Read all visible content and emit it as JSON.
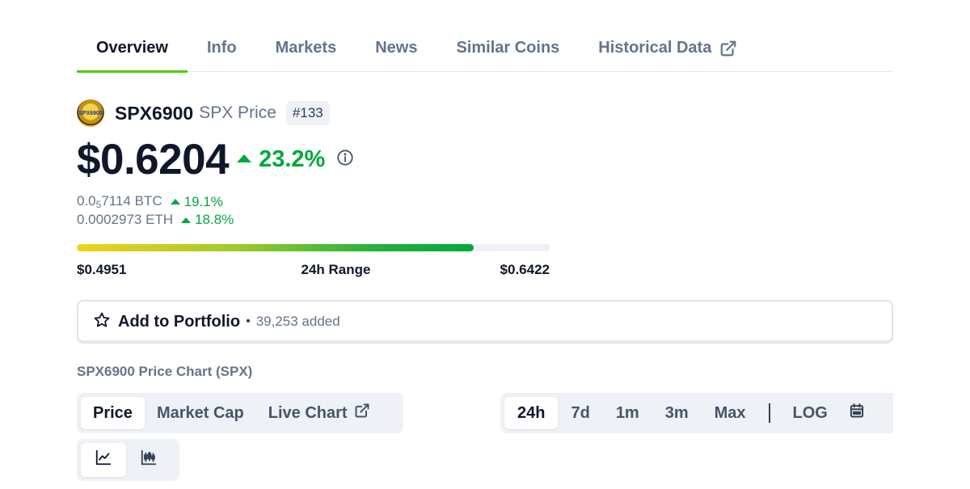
{
  "tabs": [
    {
      "label": "Overview",
      "active": true
    },
    {
      "label": "Info"
    },
    {
      "label": "Markets"
    },
    {
      "label": "News"
    },
    {
      "label": "Similar Coins"
    },
    {
      "label": "Historical Data",
      "icon": "external-link-icon"
    }
  ],
  "coin": {
    "name": "SPX6900",
    "symbol_label": "SPX Price",
    "rank": "#133",
    "logo_text": "SPX6900",
    "price": "$0.6204",
    "change_24h": "23.2%",
    "change_direction": "up"
  },
  "conversions": [
    {
      "value_prefix": "0.0",
      "value_sub": "5",
      "value_suffix": "7114 BTC",
      "change": "19.1%"
    },
    {
      "value": "0.0002973 ETH",
      "change": "18.8%"
    }
  ],
  "range": {
    "low": "$0.4951",
    "label": "24h Range",
    "high": "$0.6422",
    "position_pct": 84
  },
  "portfolio": {
    "label": "Add to Portfolio",
    "separator": "•",
    "count": "39,253 added"
  },
  "chart": {
    "title": "SPX6900 Price Chart (SPX)",
    "types": [
      {
        "label": "Price",
        "active": true
      },
      {
        "label": "Market Cap"
      },
      {
        "label": "Live Chart",
        "icon": "external-link-icon"
      }
    ],
    "ranges": [
      "24h",
      "7d",
      "1m",
      "3m",
      "Max"
    ],
    "active_range": "24h",
    "scale_label": "LOG",
    "views": [
      "line-chart-icon",
      "candlestick-icon"
    ]
  },
  "colors": {
    "positive": "#00a83e",
    "tab_accent": "#4bcc00",
    "muted": "#64748b"
  }
}
